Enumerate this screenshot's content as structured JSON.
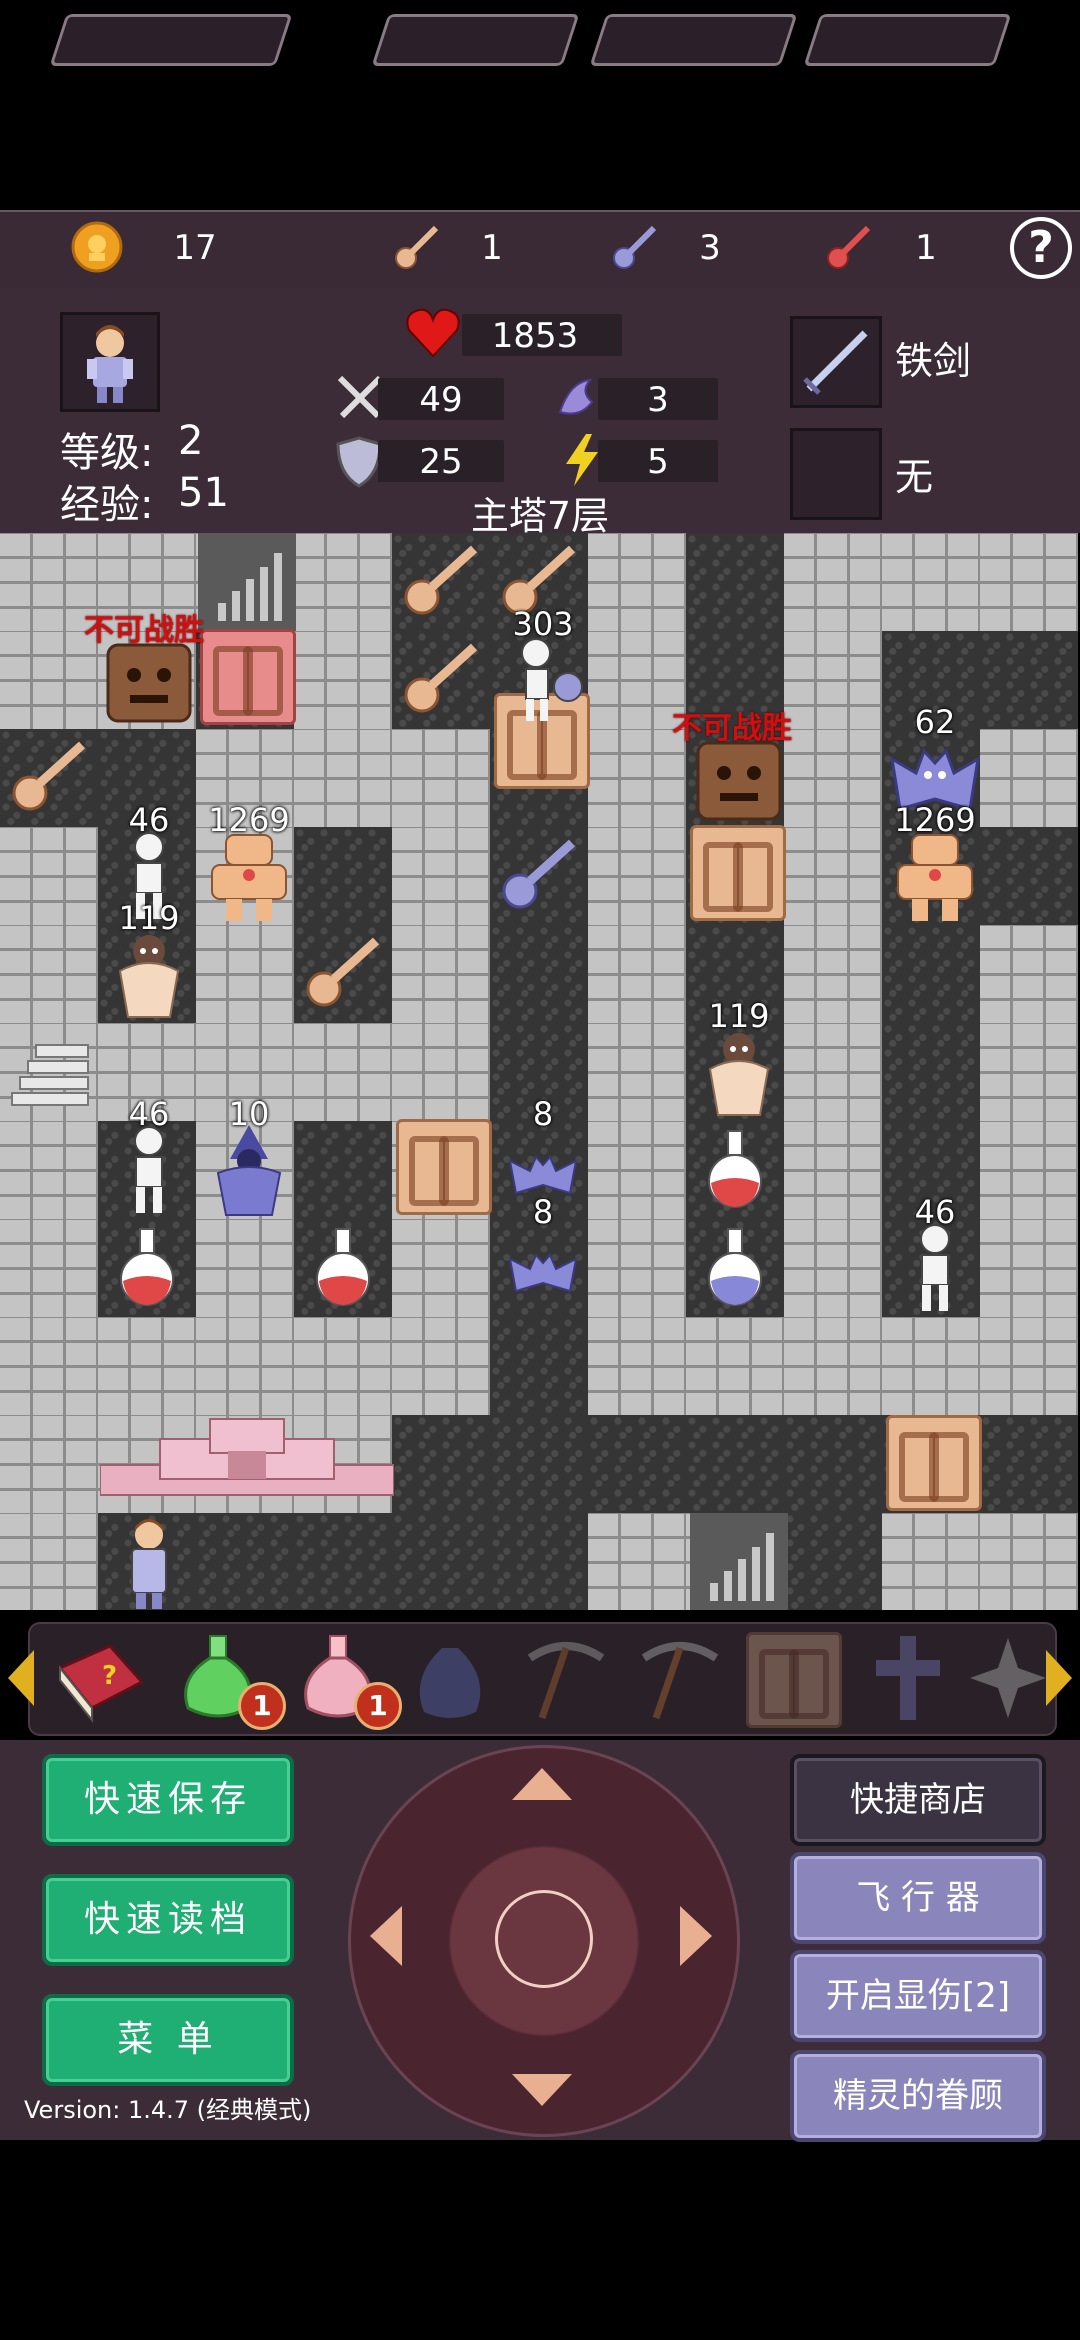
{
  "resources": {
    "gold": "17",
    "yellow_keys": "1",
    "blue_keys": "3",
    "red_keys": "1",
    "help": "?"
  },
  "hero": {
    "level_label": "等级:",
    "level": "2",
    "exp_label": "经验:",
    "exp": "51",
    "hp": "1853",
    "attack": "49",
    "defense": "25",
    "magic_defense": "3",
    "agility": "5"
  },
  "floor_name": "主塔7层",
  "equipment": {
    "weapon": "铁剑",
    "armor": "无"
  },
  "map": {
    "labels": {
      "invincible_1": "不可战胜",
      "invincible_2": "不可战胜",
      "skeleton_captain": "303",
      "bat_blue": "62",
      "golem_1": "1269",
      "golem_2": "1269",
      "skeleton_1": "46",
      "priest_1": "119",
      "priest_2": "119",
      "skeleton_2": "46",
      "mage": "10",
      "bat_1": "8",
      "bat_2": "8",
      "skeleton_3": "46"
    }
  },
  "items": {
    "green_potion_count": "1",
    "pink_potion_count": "1"
  },
  "buttons": {
    "quick_save": "快速保存",
    "quick_load": "快速读档",
    "menu": "菜  单",
    "quick_shop": "快捷商店",
    "flyer": "飞 行 器",
    "show_damage": "开启显伤[2]",
    "fairy": "精灵的眷顾"
  },
  "version": "Version: 1.4.7 (经典模式)",
  "colors": {
    "green_button": "#1fae74",
    "purple_button": "#8a85ba",
    "panel": "#3c2c38",
    "damage_warning": "#d01010"
  }
}
